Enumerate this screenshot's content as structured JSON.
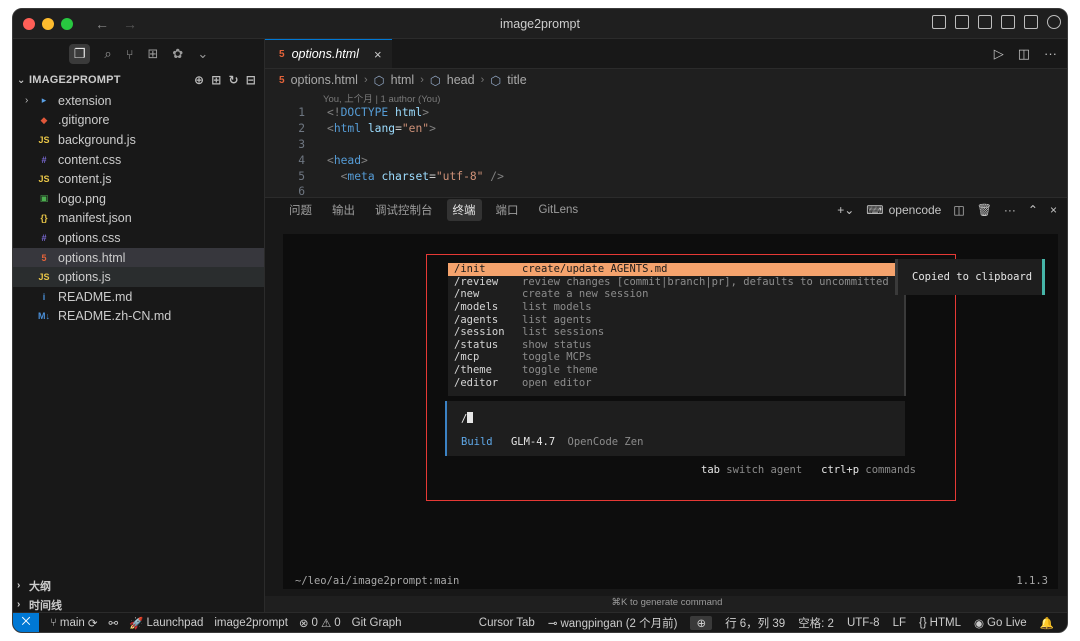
{
  "window": {
    "title": "image2prompt"
  },
  "sidebar": {
    "explorer_title": "IMAGE2PROMPT",
    "items": [
      {
        "label": "extension",
        "icon": "folder-icon",
        "icon_glyph": "▸",
        "color": "#5aa0e6"
      },
      {
        "label": ".gitignore",
        "icon": "git-icon",
        "icon_glyph": "◆",
        "color": "#e0573a"
      },
      {
        "label": "background.js",
        "icon": "js-file-icon",
        "icon_glyph": "JS",
        "color": "#e8c547"
      },
      {
        "label": "content.css",
        "icon": "css-file-icon",
        "icon_glyph": "#",
        "color": "#7b6ad6"
      },
      {
        "label": "content.js",
        "icon": "js-file-icon",
        "icon_glyph": "JS",
        "color": "#e8c547"
      },
      {
        "label": "logo.png",
        "icon": "image-file-icon",
        "icon_glyph": "▣",
        "color": "#4caf50"
      },
      {
        "label": "manifest.json",
        "icon": "json-file-icon",
        "icon_glyph": "{}",
        "color": "#e8c547"
      },
      {
        "label": "options.css",
        "icon": "css-file-icon",
        "icon_glyph": "#",
        "color": "#7b6ad6"
      },
      {
        "label": "options.html",
        "icon": "html-file-icon",
        "icon_glyph": "5",
        "color": "#e4633a"
      },
      {
        "label": "options.js",
        "icon": "js-file-icon",
        "icon_glyph": "JS",
        "color": "#e8c547"
      },
      {
        "label": "README.md",
        "icon": "info-icon",
        "icon_glyph": "i",
        "color": "#4a90d9"
      },
      {
        "label": "README.zh-CN.md",
        "icon": "markdown-icon",
        "icon_glyph": "M↓",
        "color": "#4a90d9"
      }
    ],
    "outline_label": "大纲",
    "timeline_label": "时间线"
  },
  "editor": {
    "tab_label": "options.html",
    "breadcrumb": [
      "options.html",
      "html",
      "head",
      "title"
    ],
    "blame": "You, 上个月 | 1 author (You)",
    "lines": [
      {
        "num": "1"
      },
      {
        "num": "2"
      },
      {
        "num": "3"
      },
      {
        "num": "4"
      },
      {
        "num": "5"
      },
      {
        "num": "6"
      }
    ]
  },
  "panel": {
    "tabs": [
      "问题",
      "输出",
      "调试控制台",
      "终端",
      "端口",
      "GitLens"
    ],
    "active_tab": "终端",
    "terminal_name": "opencode"
  },
  "terminal": {
    "commands": [
      {
        "name": "/init",
        "desc": "create/update AGENTS.md",
        "highlighted": true
      },
      {
        "name": "/review",
        "desc": "review changes [commit|branch|pr], defaults to uncommitted",
        "highlighted": false
      },
      {
        "name": "/new",
        "desc": "create a new session",
        "highlighted": false
      },
      {
        "name": "/models",
        "desc": "list models",
        "highlighted": false
      },
      {
        "name": "/agents",
        "desc": "list agents",
        "highlighted": false
      },
      {
        "name": "/session",
        "desc": "list sessions",
        "highlighted": false
      },
      {
        "name": "/status",
        "desc": "show status",
        "highlighted": false
      },
      {
        "name": "/mcp",
        "desc": "toggle MCPs",
        "highlighted": false
      },
      {
        "name": "/theme",
        "desc": "toggle theme",
        "highlighted": false
      },
      {
        "name": "/editor",
        "desc": "open editor",
        "highlighted": false
      }
    ],
    "input_text": "/",
    "mode": "Build",
    "model": "GLM-4.7",
    "provider": "OpenCode Zen",
    "hint_key1": "tab",
    "hint_text1": "switch agent",
    "hint_key2": "ctrl+p",
    "hint_text2": "commands",
    "toast": "Copied to clipboard",
    "cwd": "~/leo/ai/image2prompt:main",
    "version": "1.1.3"
  },
  "generate_hint": "⌘K to generate command",
  "statusbar": {
    "branch": "main",
    "launchpad": "Launchpad",
    "repo": "image2prompt",
    "errors": "0",
    "warnings": "0",
    "git_graph": "Git Graph",
    "cursor_tab": "Cursor Tab",
    "blame": "wangpingan (2 个月前)",
    "position": "行 6，列 39",
    "spaces": "空格: 2",
    "encoding": "UTF-8",
    "eol": "LF",
    "language": "HTML",
    "golive": "Go Live"
  },
  "colors": {
    "accent": "#0078d4",
    "highlight": "#f5a36d",
    "annotation": "#e53935"
  }
}
